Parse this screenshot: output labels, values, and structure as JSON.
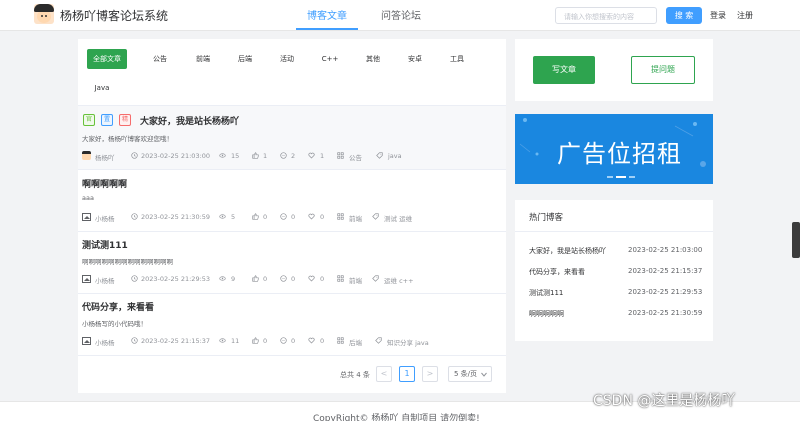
{
  "header": {
    "site_title": "杨杨吖博客论坛系统",
    "tabs": [
      {
        "label": "博客文章",
        "active": true
      },
      {
        "label": "问答论坛",
        "active": false
      }
    ],
    "search_placeholder": "请输入你想搜索的内容",
    "search_button": "搜 索",
    "login": "登录",
    "register": "注册",
    "accent_color": "#409eff"
  },
  "categories": [
    {
      "label": "全部文章",
      "active": true
    },
    {
      "label": "公告"
    },
    {
      "label": "前端"
    },
    {
      "label": "后端"
    },
    {
      "label": "活动"
    },
    {
      "label": "C++"
    },
    {
      "label": "其他"
    },
    {
      "label": "安卓"
    },
    {
      "label": "工具"
    },
    {
      "label": "Java"
    }
  ],
  "posts": [
    {
      "badges": [
        "官",
        "置",
        "精"
      ],
      "title": "大家好，我是站长杨杨吖",
      "summary": "大家好，杨杨吖博客欢迎您哦！",
      "author": "杨杨吖",
      "time": "2023-02-25 21:03:00",
      "views": "15",
      "likes": "1",
      "comments": "2",
      "favorites": "1",
      "category": "公告",
      "tags": "java"
    },
    {
      "title": "啊啊啊啊啊",
      "summary": "aaa",
      "author": "小杨杨",
      "time": "2023-02-25 21:30:59",
      "views": "5",
      "likes": "0",
      "comments": "0",
      "favorites": "0",
      "category": "前端",
      "tags": "测试  运维"
    },
    {
      "title": "测试测111",
      "summary": "啊啊啊啊啊啊啊啊啊啊啊啊啊啊",
      "author": "小杨杨",
      "time": "2023-02-25 21:29:53",
      "views": "9",
      "likes": "0",
      "comments": "0",
      "favorites": "0",
      "category": "前端",
      "tags": "运维  c++"
    },
    {
      "title": "代码分享，来看看",
      "summary": "小杨杨写的小代码哦！",
      "author": "小杨杨",
      "time": "2023-02-25 21:15:37",
      "views": "11",
      "likes": "0",
      "comments": "0",
      "favorites": "0",
      "category": "后端",
      "tags": "知识分享  java"
    }
  ],
  "pagination": {
    "total": "总共 4 条",
    "prev": "<",
    "current": "1",
    "next": ">",
    "page_size": "5 条/页"
  },
  "sidebar": {
    "write_button": "写文章",
    "ask_button": "提问题",
    "ad_text": "广告位招租",
    "hot_title": "热门博客",
    "hot_list": [
      {
        "title": "大家好，我是站长杨杨吖",
        "time": "2023-02-25 21:03:00"
      },
      {
        "title": "代码分享，来看看",
        "time": "2023-02-25 21:15:37"
      },
      {
        "title": "测试测111",
        "time": "2023-02-25 21:29:53"
      },
      {
        "title": "啊啊啊啊啊",
        "time": "2023-02-25 21:30:59"
      }
    ]
  },
  "footer": {
    "copyright": "CopyRight© 杨杨吖 自制项目 请勿倒卖!"
  },
  "watermark": "CSDN @这里是杨杨吖",
  "colors": {
    "green": "#2ea44f",
    "blue": "#409eff",
    "ad_bg": "#1a87e0"
  }
}
